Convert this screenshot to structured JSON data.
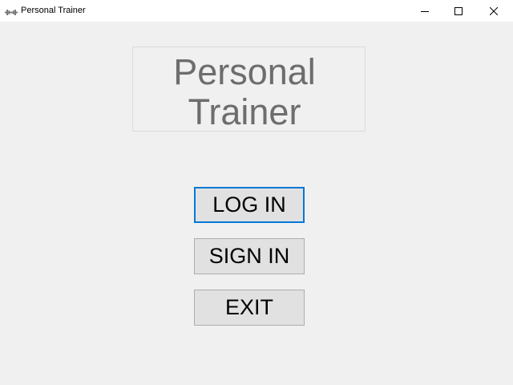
{
  "window": {
    "title": "Personal Trainer",
    "app_icon": "dumbbell-icon"
  },
  "title_panel": {
    "line1": "Personal",
    "line2": "Trainer"
  },
  "buttons": {
    "login": "LOG IN",
    "signin": "SIGN IN",
    "exit": "EXIT"
  },
  "colors": {
    "background": "#f0f0f0",
    "title_text": "#6d6d6d",
    "button_face": "#e1e1e1",
    "focus_border": "#0078d7"
  }
}
